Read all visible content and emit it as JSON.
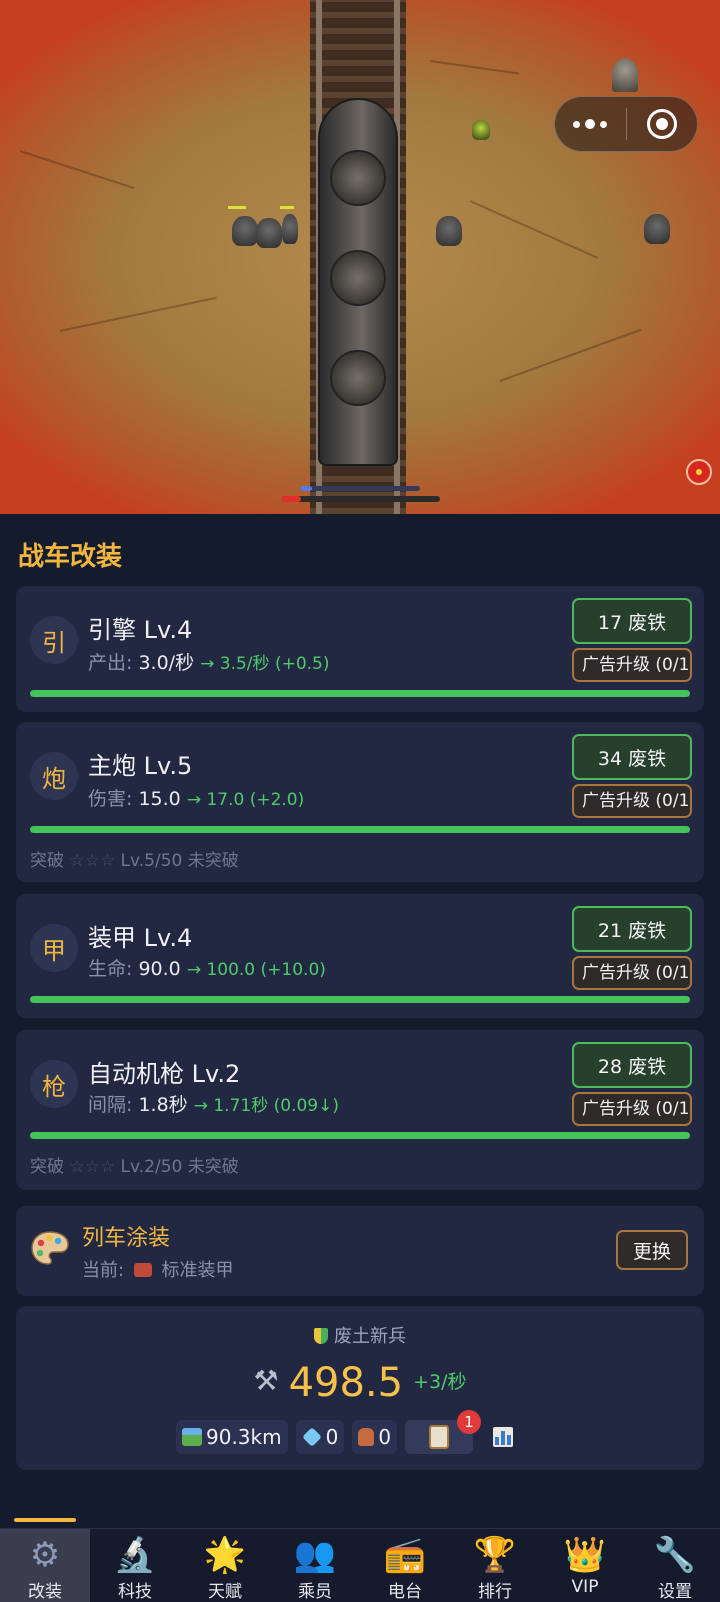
{
  "hud": {
    "progress_fraction": 0.12,
    "top_bar_fraction": 0.1
  },
  "section_title": "战车改装",
  "upgrades": [
    {
      "badge": "引",
      "name": "引擎 Lv.4",
      "stat_label": "产出:",
      "stat_current": "3.0/秒",
      "stat_next": "→ 3.5/秒 (+0.5)",
      "cost": "17 废铁",
      "ad_upgrade": "广告升级 (0/1",
      "progress": 1.0
    },
    {
      "badge": "炮",
      "name": "主炮 Lv.5",
      "stat_label": "伤害:",
      "stat_current": "15.0",
      "stat_next": "→ 17.0 (+2.0)",
      "cost": "34 废铁",
      "ad_upgrade": "广告升级 (0/1",
      "progress": 1.0,
      "breakthrough": {
        "label": "突破",
        "stars": "☆☆☆",
        "detail": "Lv.5/50 未突破"
      }
    },
    {
      "badge": "甲",
      "name": "装甲 Lv.4",
      "stat_label": "生命:",
      "stat_current": "90.0",
      "stat_next": "→ 100.0 (+10.0)",
      "cost": "21 废铁",
      "ad_upgrade": "广告升级 (0/1",
      "progress": 1.0
    },
    {
      "badge": "枪",
      "name": "自动机枪 Lv.2",
      "stat_label": "间隔:",
      "stat_current": "1.8秒",
      "stat_next": "→ 1.71秒 (0.09↓)",
      "cost": "28 废铁",
      "ad_upgrade": "广告升级 (0/1",
      "progress": 1.0,
      "breakthrough": {
        "label": "突破",
        "stars": "☆☆☆",
        "detail": "Lv.2/50 未突破"
      }
    }
  ],
  "paint": {
    "title": "列车涂装",
    "current_label": "当前:",
    "current_value": "标准装甲",
    "change_button": "更换"
  },
  "status": {
    "rank": "废土新兵",
    "scrap": "498.5",
    "scrap_rate": "+3/秒",
    "distance": "90.3km",
    "gems": "0",
    "pots": "0",
    "task_badge": "1"
  },
  "nav": [
    {
      "label": "改装",
      "icon": "gear-icon",
      "glyph": "⚙",
      "color": "#8a9ab8",
      "active": true
    },
    {
      "label": "科技",
      "icon": "microscope-icon",
      "glyph": "🔬",
      "color": "#c8ccd6"
    },
    {
      "label": "天赋",
      "icon": "star-burst-icon",
      "glyph": "🌟",
      "color": "#f6c23a"
    },
    {
      "label": "乘员",
      "icon": "users-icon",
      "glyph": "👥",
      "color": "#5a8ae8"
    },
    {
      "label": "电台",
      "icon": "radio-icon",
      "glyph": "📻",
      "color": "#c8ccd6"
    },
    {
      "label": "排行",
      "icon": "trophy-icon",
      "glyph": "🏆",
      "color": "#f2b640"
    },
    {
      "label": "VIP",
      "icon": "crown-icon",
      "glyph": "👑",
      "color": "#f6c23a"
    },
    {
      "label": "设置",
      "icon": "wrench-icon",
      "glyph": "🔧",
      "color": "#c8ccd6"
    }
  ],
  "colors": {
    "accent": "#f2b640",
    "upgrade_green": "#4ecb6a",
    "background": "#141b2d",
    "card": "#222842"
  }
}
